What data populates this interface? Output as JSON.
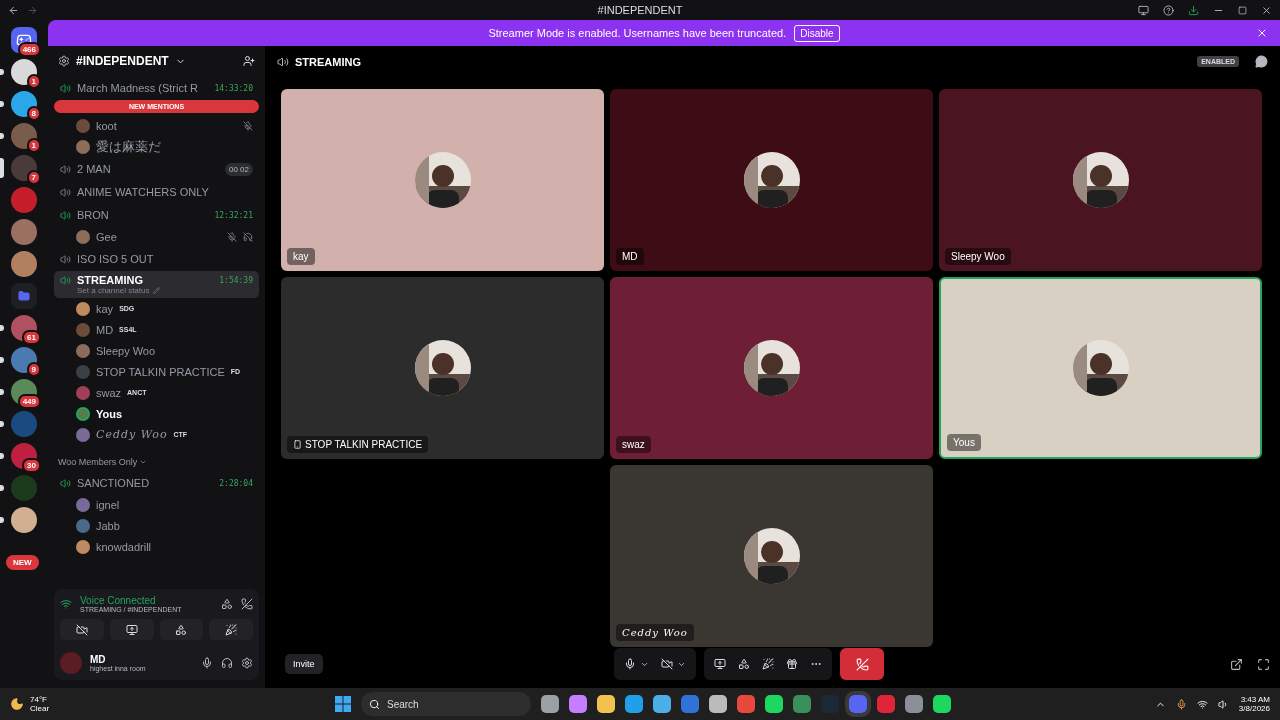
{
  "window": {
    "title": "#INDEPENDENT"
  },
  "banner": {
    "text": "Streamer Mode is enabled. Usernames have been truncated.",
    "button": "Disable"
  },
  "servers": [
    {
      "kind": "home",
      "badge": "466"
    },
    {
      "kind": "server",
      "badge": "1",
      "unread": true,
      "selected": false
    },
    {
      "kind": "server",
      "badge": "8",
      "unread": true,
      "selected": false
    },
    {
      "kind": "server",
      "badge": "1",
      "unread": true,
      "selected": false
    },
    {
      "kind": "server",
      "badge": "7",
      "unread": false,
      "selected": true
    },
    {
      "kind": "server",
      "unread": false,
      "selected": false
    },
    {
      "kind": "server",
      "unread": false,
      "selected": false
    },
    {
      "kind": "server",
      "unread": false,
      "selected": false
    },
    {
      "kind": "folder"
    },
    {
      "kind": "server",
      "badge": "61",
      "unread": true,
      "selected": false
    },
    {
      "kind": "server",
      "badge": "9",
      "unread": true,
      "selected": false
    },
    {
      "kind": "server",
      "badge": "449",
      "unread": true,
      "selected": false
    },
    {
      "kind": "server",
      "unread": true,
      "selected": false
    },
    {
      "kind": "server",
      "badge": "30",
      "unread": true,
      "selected": false
    },
    {
      "kind": "server",
      "unread": true,
      "selected": false
    },
    {
      "kind": "server",
      "unread": true,
      "selected": false
    }
  ],
  "new_pill": "NEW",
  "sidebar": {
    "title": "#INDEPENDENT",
    "new_mentions": "NEW MENTIONS",
    "items": [
      {
        "kind": "channel",
        "name": "March Madness (Strict R",
        "active": true,
        "time": "14:33:20",
        "selected": false,
        "members": [
          {
            "name": "koot",
            "speaking": false,
            "muted": true
          },
          {
            "name": "愛は麻薬だ",
            "speaking": false,
            "muted": false
          }
        ]
      },
      {
        "kind": "channel",
        "name": "2 MAN",
        "active": false,
        "selected": false,
        "counter": [
          "00",
          "02"
        ]
      },
      {
        "kind": "channel",
        "name": "ANIME WATCHERS ONLY",
        "active": false,
        "selected": false
      },
      {
        "kind": "channel",
        "name": "BRON",
        "active": true,
        "time": "12:32:21",
        "selected": false,
        "members": [
          {
            "name": "Gee",
            "speaking": false,
            "muted": true,
            "deafened": true
          }
        ]
      },
      {
        "kind": "channel",
        "name": "ISO ISO 5 OUT",
        "active": false,
        "selected": false
      },
      {
        "kind": "channel",
        "name": "STREAMING",
        "active": true,
        "time": "1:54:39",
        "selected": true,
        "status": "Set a channel status",
        "members": [
          {
            "name": "kay",
            "speaking": false,
            "tag": "SDG"
          },
          {
            "name": "MD",
            "speaking": false,
            "tag": "SS4L"
          },
          {
            "name": "Sleepy Woo",
            "speaking": false
          },
          {
            "name": "STOP TALKIN PRACTICE",
            "speaking": false,
            "tag": "FD"
          },
          {
            "name": "swaz",
            "speaking": false,
            "tag": "ANCT"
          },
          {
            "name": "Yous",
            "speaking": true
          },
          {
            "name": "Ceddy Woo",
            "speaking": false,
            "fancy": true,
            "tag": "CTF"
          }
        ]
      },
      {
        "kind": "category",
        "name": "Woo Members Only"
      },
      {
        "kind": "channel",
        "name": "SANCTIONED",
        "active": true,
        "time": "2:28:04",
        "selected": false,
        "members": [
          {
            "name": "ignel",
            "speaking": false
          },
          {
            "name": "Jabb",
            "speaking": false
          },
          {
            "name": "knowdadrill",
            "speaking": false
          }
        ]
      }
    ]
  },
  "voice": {
    "status": "Voice Connected",
    "channel": "STREAMING / #INDEPENDENT"
  },
  "user": {
    "name": "MD",
    "status": "highest inna room"
  },
  "stage": {
    "title": "STREAMING",
    "badge": "ENABLED",
    "invite": "Invite",
    "tiles": [
      {
        "name": "kay",
        "color": "#d2b1ad",
        "speaking": false
      },
      {
        "name": "MD",
        "color": "#3d0c14",
        "speaking": false
      },
      {
        "name": "Sleepy Woo",
        "color": "#4a1420",
        "speaking": false
      },
      {
        "name": "STOP TALKIN PRACTICE",
        "color": "#2c2c2c",
        "speaking": false,
        "mobile": true
      },
      {
        "name": "swaz",
        "color": "#6e1f36",
        "speaking": false
      },
      {
        "name": "Yous",
        "color": "#d8d0c2",
        "speaking": true
      },
      {
        "name": "Ceddy Woo",
        "color": "#3a3733",
        "speaking": false,
        "fancy": true
      }
    ]
  },
  "taskbar": {
    "weather": {
      "temp": "74°F",
      "text": "Clear"
    },
    "search": {
      "placeholder": "Search"
    },
    "apps": [
      {
        "color": "#9aa0a6",
        "selected": false
      },
      {
        "color": "#c77dff",
        "selected": false
      },
      {
        "color": "#f2c14e",
        "selected": false
      },
      {
        "color": "#1fa0e8",
        "selected": false
      },
      {
        "color": "#4cb0e8",
        "selected": false
      },
      {
        "color": "#2f73d9",
        "selected": false
      },
      {
        "color": "#bbbbbb",
        "selected": false
      },
      {
        "color": "#e8493b",
        "selected": false
      },
      {
        "color": "#1ed760",
        "selected": false
      },
      {
        "color": "#3a8f5a",
        "selected": false
      },
      {
        "color": "#1b2838",
        "selected": false
      },
      {
        "color": "#5865f2",
        "selected": true
      },
      {
        "color": "#e0243a",
        "selected": false
      },
      {
        "color": "#8a8f98",
        "selected": false
      },
      {
        "color": "#1ed760",
        "selected": false
      }
    ],
    "time": "3:43 AM",
    "date": "3/8/2026"
  }
}
